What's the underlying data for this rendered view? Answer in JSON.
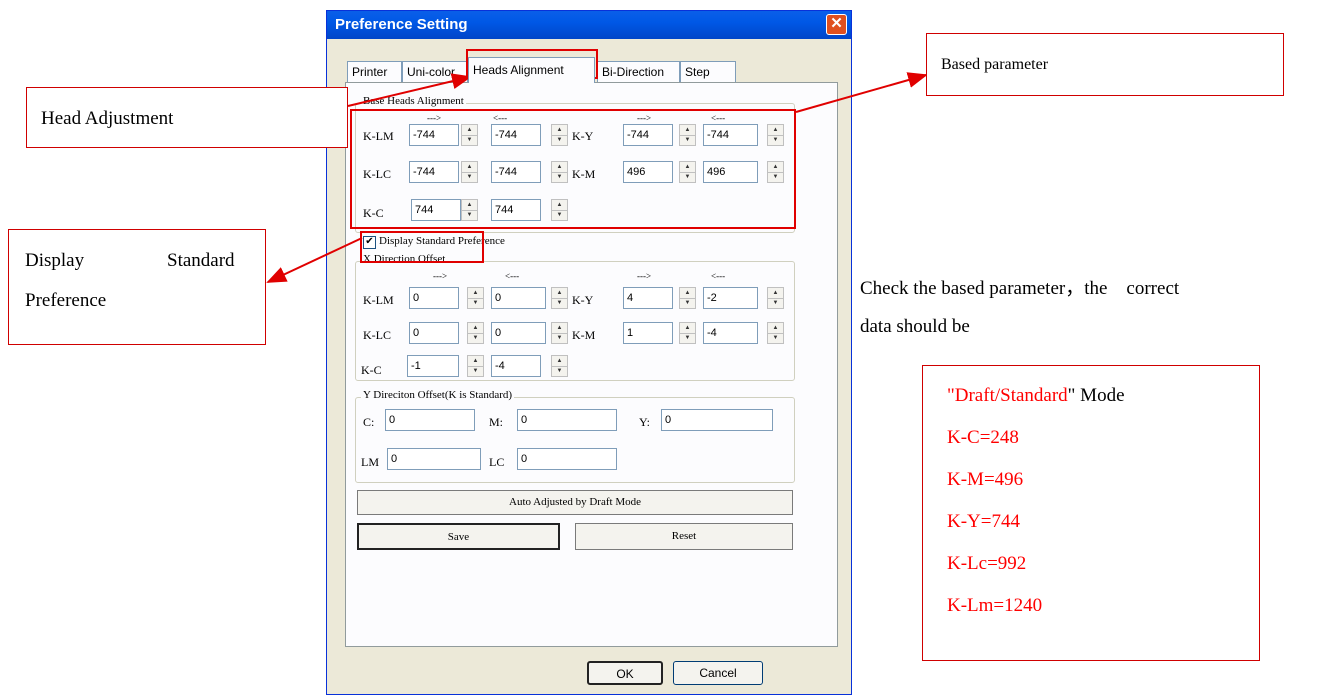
{
  "dialog": {
    "title": "Preference Setting",
    "close_glyph": "✕",
    "tabs": [
      {
        "label": "Printer",
        "active": false
      },
      {
        "label": "Uni-color",
        "active": false
      },
      {
        "label": "Heads Alignment",
        "active": true
      },
      {
        "label": "Bi-Direction",
        "active": false
      },
      {
        "label": "Step",
        "active": false
      }
    ],
    "base_group": {
      "title": "Base Heads Alignment",
      "arrow_right": "--->",
      "arrow_left": "<---",
      "rows": [
        {
          "label": "K-LM",
          "v1": "-744",
          "v2": "-744",
          "label_b": "K-Y",
          "v3": "-744",
          "v4": "-744"
        },
        {
          "label": "K-LC",
          "v1": "-744",
          "v2": "-744",
          "label_b": "K-M",
          "v3": "496",
          "v4": "496"
        },
        {
          "label": "K-C",
          "v1": "744",
          "v2": "744"
        }
      ]
    },
    "display_standard": {
      "label": "Display Standard Preference",
      "checked": true,
      "check_glyph": "✔"
    },
    "x_group": {
      "title": "X Direction Offset",
      "arrow_right": "--->",
      "arrow_left": "<---",
      "rows": [
        {
          "label": "K-LM",
          "v1": "0",
          "v2": "0",
          "label_b": "K-Y",
          "v3": "4",
          "v4": "-2"
        },
        {
          "label": "K-LC",
          "v1": "0",
          "v2": "0",
          "label_b": "K-M",
          "v3": "1",
          "v4": "-4"
        },
        {
          "label": "K-C",
          "v1": "-1",
          "v2": "-4"
        }
      ]
    },
    "y_group": {
      "title": "Y Direciton Offset(K is Standard)",
      "c_label": "C:",
      "c_value": "0",
      "m_label": "M:",
      "m_value": "0",
      "y_label": "Y:",
      "y_value": "0",
      "lm_label": "LM",
      "lm_value": "0",
      "lc_label": "LC",
      "lc_value": "0"
    },
    "auto_adjust_label": "Auto Adjusted by Draft Mode",
    "save_label": "Save",
    "reset_label": "Reset",
    "ok_label": "OK",
    "cancel_label": "Cancel",
    "spin_up_glyph": "▲",
    "spin_down_glyph": "▼"
  },
  "annotations": {
    "head_adjustment": "Head Adjustment",
    "based_parameter": "Based parameter",
    "display_word1": "Display",
    "display_word2": "Standard",
    "display_word3": "Preference",
    "check_line1": "Check the based parameter，the    correct",
    "check_line2": "data should be",
    "mode_quoted": "\"Draft/Standard",
    "mode_suffix": "\" Mode",
    "values": [
      "K-C=248",
      "K-M=496",
      "K-Y=744",
      "K-Lc=992",
      "K-Lm=1240"
    ]
  },
  "colors": {
    "annotation_red": "#e00000",
    "title_blue": "#0058e6"
  }
}
